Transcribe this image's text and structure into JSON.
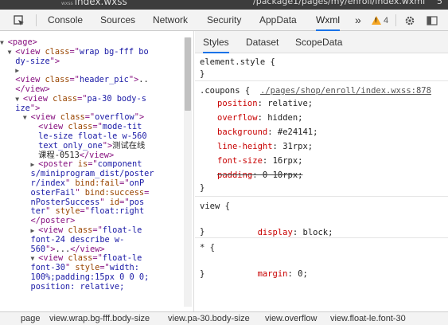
{
  "window": {
    "title_prefix": "wxss",
    "title": "index.wxss",
    "path_text": "/package1/pages/my/enroll/index.wxml",
    "right_edge_text": "5"
  },
  "toolbar": {
    "tabs": [
      "Console",
      "Sources",
      "Network",
      "Security",
      "AppData",
      "Wxml"
    ],
    "active_tab": "Wxml",
    "more_label": "»",
    "warning_count": "4"
  },
  "elements_tree": [
    {
      "indent": "▼ ",
      "parts": [
        [
          "tg",
          "<page>"
        ]
      ]
    },
    {
      "indent": "  ▼ ",
      "parts": [
        [
          "tg",
          "<view "
        ],
        [
          "an",
          "class"
        ],
        [
          "tg",
          "=\""
        ],
        [
          "av",
          "wrap bg-fff bo"
        ]
      ]
    },
    {
      "indent": "    ",
      "parts": [
        [
          "av",
          "dy-size"
        ],
        [
          "tg",
          "\">"
        ]
      ]
    },
    {
      "indent": "    ▶ ",
      "parts": []
    },
    {
      "indent": "    ",
      "parts": [
        [
          "tg",
          "<view "
        ],
        [
          "an",
          "class"
        ],
        [
          "tg",
          "=\""
        ],
        [
          "av",
          "header_pic"
        ],
        [
          "tg",
          "\">"
        ],
        [
          "tx",
          ".."
        ]
      ]
    },
    {
      "indent": "    ",
      "parts": [
        [
          "tg",
          "</view>"
        ]
      ]
    },
    {
      "indent": "    ▼ ",
      "parts": [
        [
          "tg",
          "<view "
        ],
        [
          "an",
          "class"
        ],
        [
          "tg",
          "=\""
        ],
        [
          "av",
          "pa-30 body-s"
        ]
      ]
    },
    {
      "indent": "    ",
      "parts": [
        [
          "av",
          "ize"
        ],
        [
          "tg",
          "\">"
        ]
      ]
    },
    {
      "indent": "      ▼ ",
      "parts": [
        [
          "tg",
          "<view "
        ],
        [
          "an",
          "class"
        ],
        [
          "tg",
          "=\""
        ],
        [
          "av",
          "overflow"
        ],
        [
          "tg",
          "\">"
        ]
      ]
    },
    {
      "indent": "          ",
      "parts": [
        [
          "tg",
          "<view "
        ],
        [
          "an",
          "class"
        ],
        [
          "tg",
          "=\""
        ],
        [
          "av",
          "mode-tit"
        ]
      ]
    },
    {
      "indent": "          ",
      "parts": [
        [
          "av",
          "le-size float-le w-560"
        ]
      ]
    },
    {
      "indent": "          ",
      "parts": [
        [
          "av",
          "text_only_one"
        ],
        [
          "tg",
          "\">"
        ],
        [
          "tx",
          "测试在线"
        ]
      ]
    },
    {
      "indent": "          ",
      "parts": [
        [
          "tx",
          "课程-0513"
        ],
        [
          "tg",
          "</view>"
        ]
      ]
    },
    {
      "indent": "        ▶ ",
      "parts": [
        [
          "tg",
          "<poster "
        ],
        [
          "an",
          "is"
        ],
        [
          "tg",
          "=\""
        ],
        [
          "av",
          "component"
        ]
      ]
    },
    {
      "indent": "        ",
      "parts": [
        [
          "av",
          "s/miniprogram_dist/poster"
        ]
      ]
    },
    {
      "indent": "        ",
      "parts": [
        [
          "av",
          "r/index"
        ],
        [
          "tg",
          "\" "
        ],
        [
          "an",
          "bind:fail"
        ],
        [
          "tg",
          "=\""
        ],
        [
          "av",
          "onP"
        ]
      ]
    },
    {
      "indent": "        ",
      "parts": [
        [
          "av",
          "osterFail"
        ],
        [
          "tg",
          "\" "
        ],
        [
          "an",
          "bind:success"
        ],
        [
          "tg",
          "="
        ]
      ]
    },
    {
      "indent": "        ",
      "parts": [
        [
          "av",
          "nPosterSuccess"
        ],
        [
          "tg",
          "\" "
        ],
        [
          "an",
          "id"
        ],
        [
          "tg",
          "=\""
        ],
        [
          "av",
          "pos"
        ]
      ]
    },
    {
      "indent": "        ",
      "parts": [
        [
          "av",
          "ter"
        ],
        [
          "tg",
          "\" "
        ],
        [
          "an",
          "style"
        ],
        [
          "tg",
          "=\""
        ],
        [
          "av",
          "float:right"
        ]
      ]
    },
    {
      "indent": "        ",
      "parts": [
        [
          "tg",
          "</poster>"
        ]
      ]
    },
    {
      "indent": "        ▶ ",
      "parts": [
        [
          "tg",
          "<view "
        ],
        [
          "an",
          "class"
        ],
        [
          "tg",
          "=\""
        ],
        [
          "av",
          "float-le"
        ]
      ]
    },
    {
      "indent": "        ",
      "parts": [
        [
          "av",
          "font-24 describe w-"
        ]
      ]
    },
    {
      "indent": "        ",
      "parts": [
        [
          "av",
          "560"
        ],
        [
          "tg",
          "\">"
        ],
        [
          "tx",
          "..."
        ],
        [
          "tg",
          "</view>"
        ]
      ]
    },
    {
      "indent": "        ▼ ",
      "parts": [
        [
          "tg",
          "<view "
        ],
        [
          "an",
          "class"
        ],
        [
          "tg",
          "=\""
        ],
        [
          "av",
          "float-le"
        ]
      ]
    },
    {
      "indent": "        ",
      "parts": [
        [
          "av",
          "font-30"
        ],
        [
          "tg",
          "\" "
        ],
        [
          "an",
          "style"
        ],
        [
          "tg",
          "=\""
        ],
        [
          "av",
          "width:"
        ]
      ]
    },
    {
      "indent": "        ",
      "parts": [
        [
          "av",
          "100%;padding:15px 0 0 0;"
        ]
      ]
    },
    {
      "indent": "        ",
      "parts": [
        [
          "av",
          "position: relative;"
        ]
      ]
    }
  ],
  "styles_panel": {
    "tabs": [
      "Styles",
      "Dataset",
      "ScopeData"
    ],
    "active_tab": "Styles",
    "element_style_selector": "element.style {",
    "close_brace": "}",
    "coupons_rule": {
      "selector": ".coupons {",
      "source": "./pages/shop/enroll/index.wxss:878",
      "props": [
        {
          "name": "position",
          "value": "relative;",
          "struck": false
        },
        {
          "name": "overflow",
          "value": "hidden;",
          "struck": false
        },
        {
          "name": "background",
          "value": "#e24141;",
          "struck": false
        },
        {
          "name": "line-height",
          "value": "31rpx;",
          "struck": false
        },
        {
          "name": "font-size",
          "value": "16rpx;",
          "struck": false
        },
        {
          "name": "padding",
          "value": "0 10rpx;",
          "struck": true
        }
      ]
    },
    "view_rule": {
      "selector": "view {",
      "props": [
        {
          "name": "display",
          "value": "block;"
        }
      ]
    },
    "star_rule": {
      "selector": "* {",
      "props": [
        {
          "name": "margin",
          "value": "0;"
        }
      ]
    }
  },
  "breadcrumb": [
    "page",
    "view.wrap.bg-fff.body-size",
    "view.pa-30.body-size",
    "view.overflow",
    "view.float-le.font-30"
  ]
}
